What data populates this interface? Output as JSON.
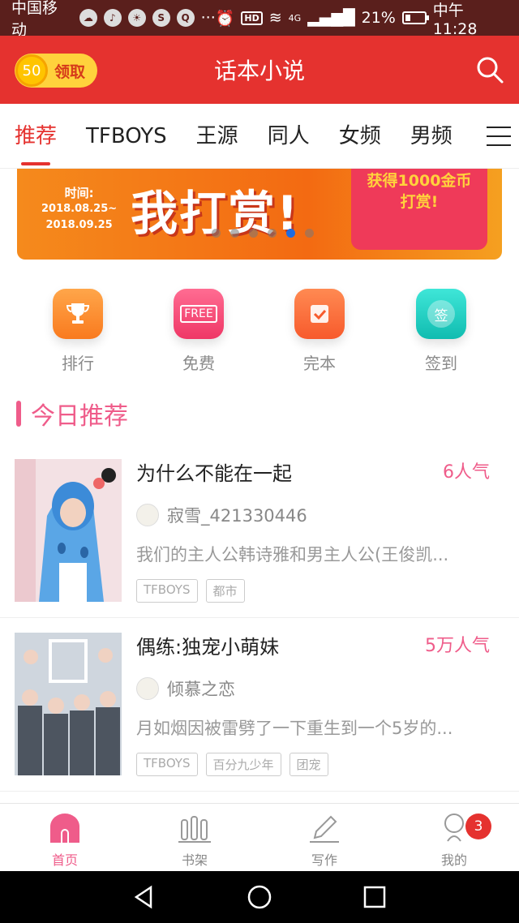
{
  "status": {
    "carrier": "中国移动",
    "signal_label": "4G",
    "battery": "21%",
    "time": "中午11:28"
  },
  "header": {
    "coin_amount": "50",
    "coin_action": "领取",
    "title": "话本小说"
  },
  "tabs": [
    {
      "label": "推荐",
      "active": true
    },
    {
      "label": "TFBOYS"
    },
    {
      "label": "王源"
    },
    {
      "label": "同人"
    },
    {
      "label": "女频"
    },
    {
      "label": "男频"
    }
  ],
  "banner": {
    "time_label": "时间:",
    "date_from": "2018.08.25~",
    "date_to": "2018.09.25",
    "headline": "我打赏!",
    "reward_line1": "获得1000金币",
    "reward_line2": "打赏!",
    "slide_count": 6,
    "active_slide": 4
  },
  "quick": [
    {
      "label": "排行",
      "icon": "trophy-icon",
      "color": "#fb8a2a"
    },
    {
      "label": "免费",
      "icon": "free-sign-icon",
      "color": "#f64c7a",
      "badge": "FREE"
    },
    {
      "label": "完本",
      "icon": "completed-check-icon",
      "color": "#fb6a3a"
    },
    {
      "label": "签到",
      "icon": "checkin-icon",
      "color": "#1fd0c4",
      "badge": "签"
    }
  ],
  "section": {
    "title": "今日推荐"
  },
  "books": [
    {
      "title": "为什么不能在一起",
      "popularity": "6人气",
      "author": "寂雪_421330446",
      "summary": "我们的主人公韩诗雅和男主人公(王俊凯...",
      "tags": [
        "TFBOYS",
        "都市"
      ]
    },
    {
      "title": "偶练:独宠小萌妹",
      "popularity": "5万人气",
      "author": "倾慕之恋",
      "summary": "月如烟因被雷劈了一下重生到一个5岁的...",
      "tags": [
        "TFBOYS",
        "百分九少年",
        "团宠"
      ]
    }
  ],
  "bottom_nav": [
    {
      "label": "首页",
      "active": true
    },
    {
      "label": "书架"
    },
    {
      "label": "写作"
    },
    {
      "label": "我的",
      "badge": "3"
    }
  ],
  "colors": {
    "brand": "#e5322f",
    "accent_pink": "#ef5c8a"
  }
}
